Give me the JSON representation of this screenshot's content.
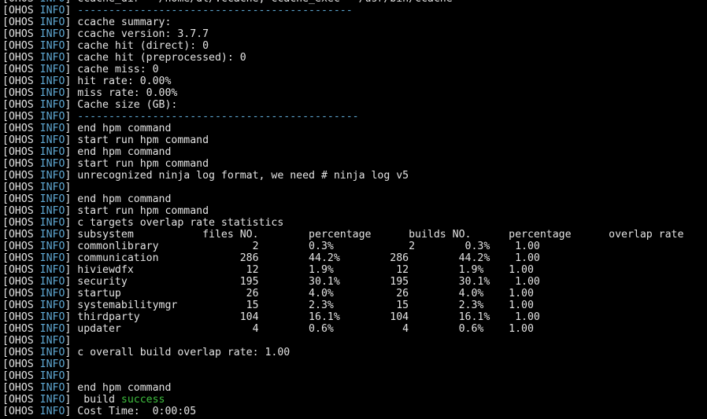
{
  "prefix": {
    "open": "[OHOS ",
    "info": "INFO",
    "close": "] "
  },
  "lines": [
    {
      "text": "ccache_dir = /home/dl/.ccache, ccache_exec = /usr/bin/ccache",
      "style": "msg"
    },
    {
      "text": "--------------------------------------------",
      "style": "sep"
    },
    {
      "text": "ccache summary:",
      "style": "msg"
    },
    {
      "text": "ccache version: 3.7.7",
      "style": "msg"
    },
    {
      "text": "cache hit (direct): 0",
      "style": "msg"
    },
    {
      "text": "cache hit (preprocessed): 0",
      "style": "msg"
    },
    {
      "text": "cache miss: 0",
      "style": "msg"
    },
    {
      "text": "hit rate: 0.00%",
      "style": "msg"
    },
    {
      "text": "miss rate: 0.00%",
      "style": "msg"
    },
    {
      "text": "Cache size (GB):",
      "style": "msg"
    },
    {
      "text": "---------------------------------------------",
      "style": "sep"
    },
    {
      "text": "end hpm command",
      "style": "msg"
    },
    {
      "text": "start run hpm command",
      "style": "msg"
    },
    {
      "text": "end hpm command",
      "style": "msg"
    },
    {
      "text": "start run hpm command",
      "style": "msg"
    },
    {
      "text": "unrecognized ninja log format, we need # ninja log v5",
      "style": "msg"
    },
    {
      "text": "",
      "style": "msg"
    },
    {
      "text": "end hpm command",
      "style": "msg"
    },
    {
      "text": "start run hpm command",
      "style": "msg"
    },
    {
      "text": "c targets overlap rate statistics",
      "style": "msg"
    },
    {
      "text": "subsystem           files NO.        percentage      builds NO.      percentage      overlap rate",
      "style": "msg"
    },
    {
      "text": "commonlibrary               2        0.3%            2        0.3%    1.00",
      "style": "msg"
    },
    {
      "text": "communication             286        44.2%        286        44.2%    1.00",
      "style": "msg"
    },
    {
      "text": "hiviewdfx                  12        1.9%          12        1.9%    1.00",
      "style": "msg"
    },
    {
      "text": "security                  195        30.1%        195        30.1%    1.00",
      "style": "msg"
    },
    {
      "text": "startup                    26        4.0%          26        4.0%    1.00",
      "style": "msg"
    },
    {
      "text": "systemabilitymgr           15        2.3%          15        2.3%    1.00",
      "style": "msg"
    },
    {
      "text": "thirdparty                104        16.1%        104        16.1%    1.00",
      "style": "msg"
    },
    {
      "text": "updater                     4        0.6%           4        0.6%    1.00",
      "style": "msg"
    },
    {
      "text": "",
      "style": "msg"
    },
    {
      "text": "c overall build overlap rate: 1.00",
      "style": "msg"
    },
    {
      "text": "",
      "style": "msg"
    },
    {
      "text": "",
      "style": "msg"
    },
    {
      "text": "end hpm command",
      "style": "msg"
    },
    {
      "text": " build ",
      "style": "msg",
      "suffix": "success"
    },
    {
      "text": "Cost Time:  0:00:05",
      "style": "msg"
    }
  ]
}
